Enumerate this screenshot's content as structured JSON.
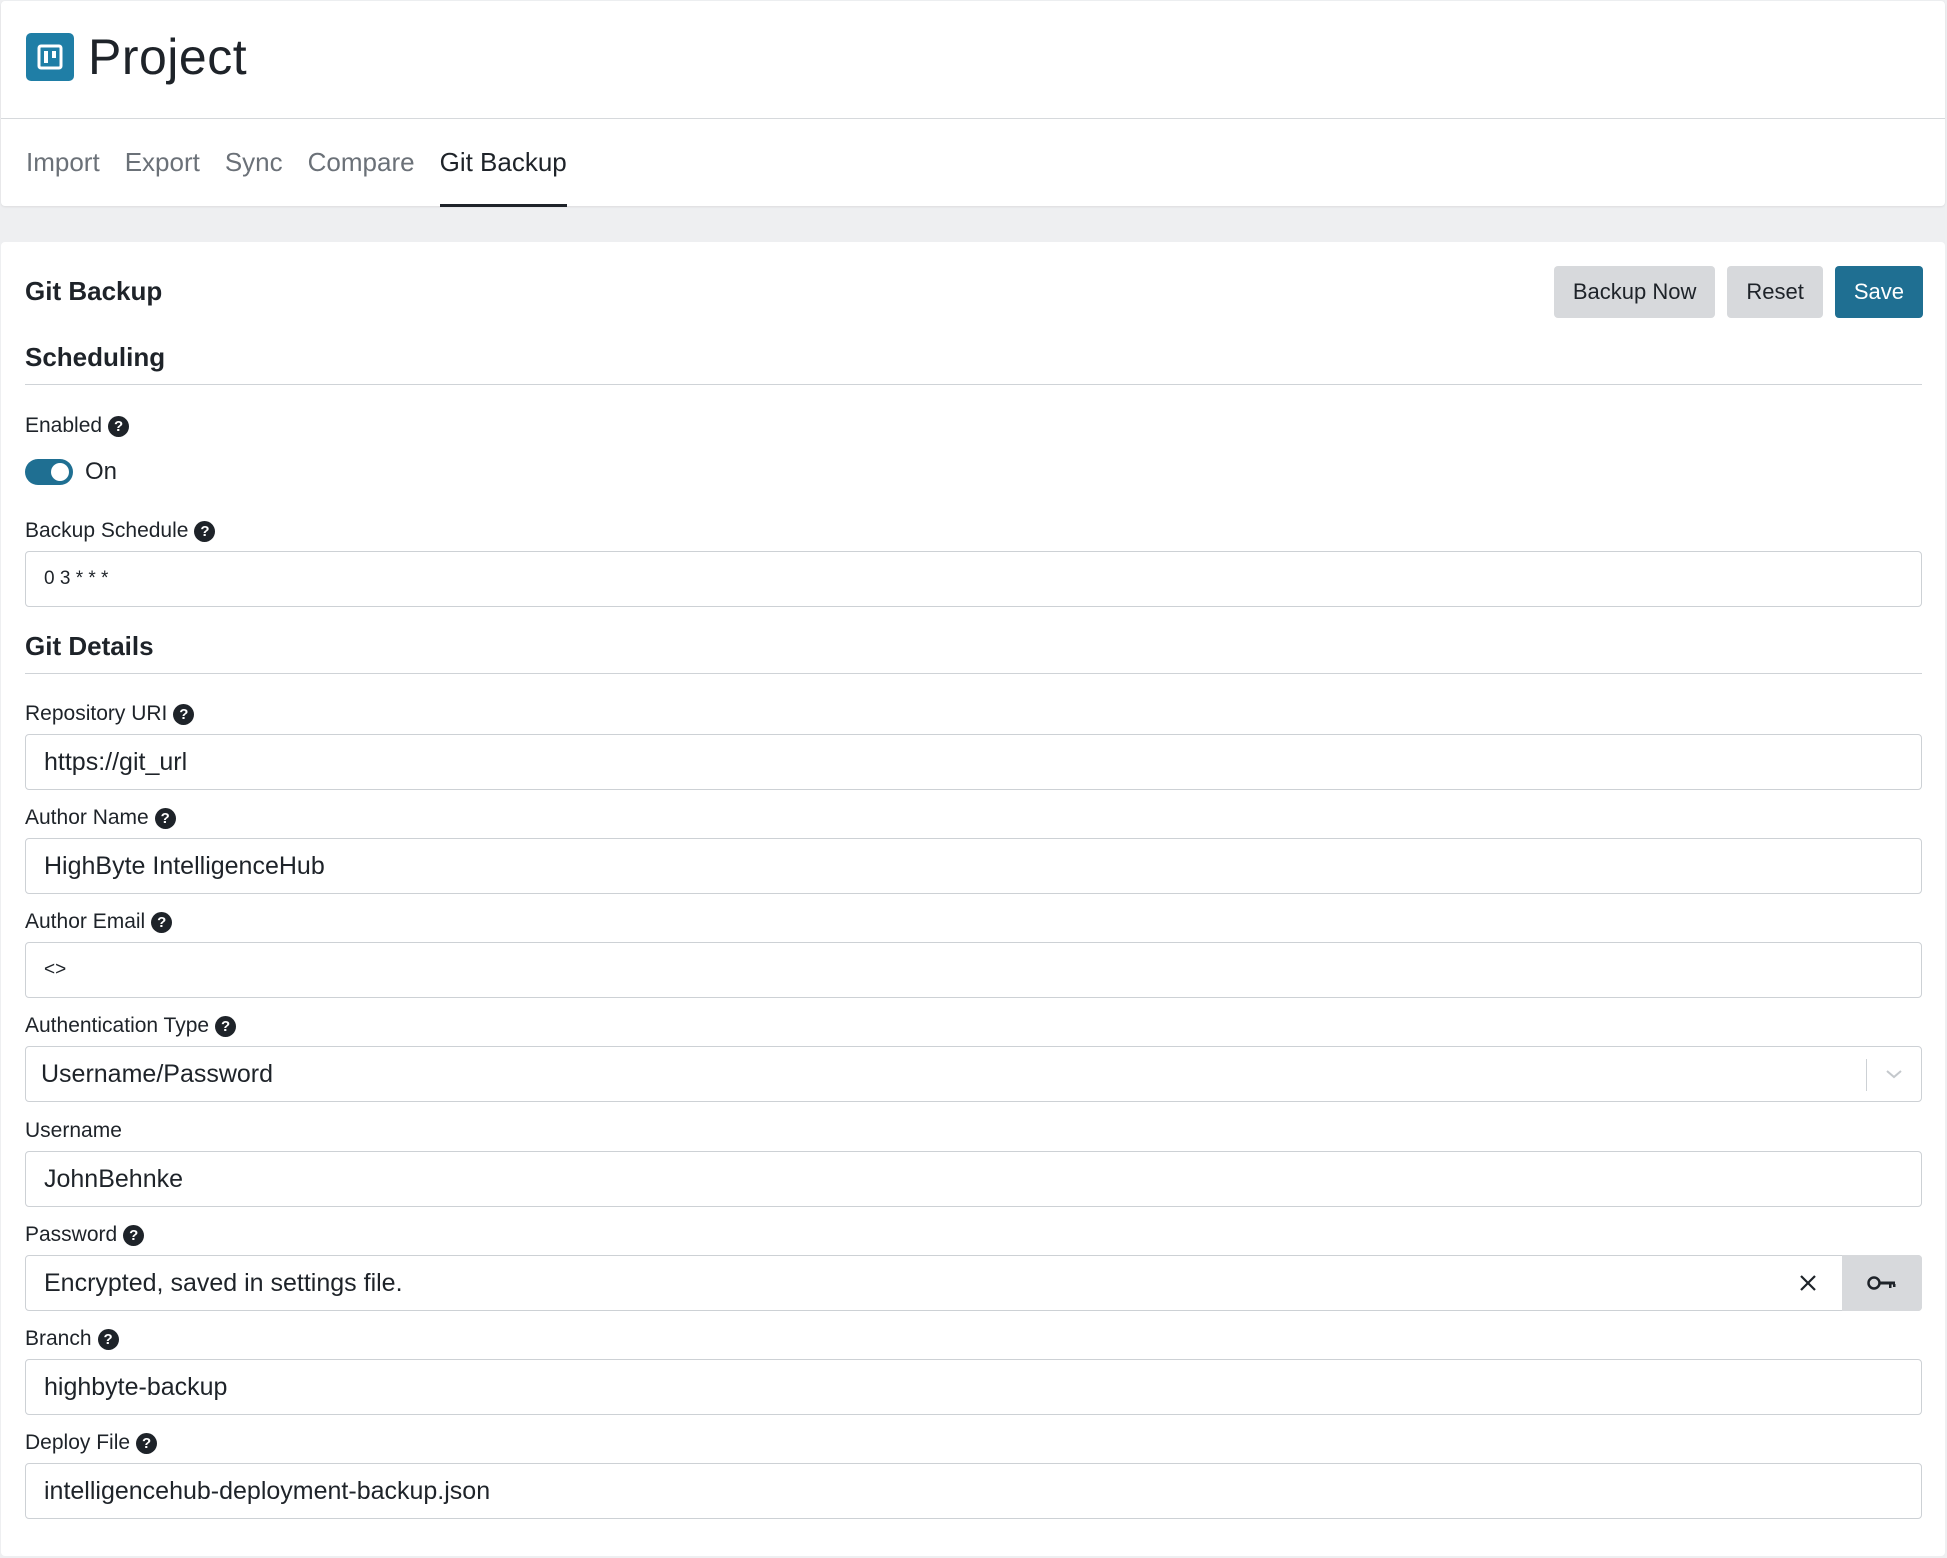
{
  "header": {
    "title": "Project",
    "icon": "project-board-icon",
    "tabs": [
      {
        "label": "Import",
        "active": false
      },
      {
        "label": "Export",
        "active": false
      },
      {
        "label": "Sync",
        "active": false
      },
      {
        "label": "Compare",
        "active": false
      },
      {
        "label": "Git Backup",
        "active": true
      }
    ]
  },
  "card": {
    "title": "Git Backup",
    "actions": {
      "backup_now": "Backup Now",
      "reset": "Reset",
      "save": "Save"
    }
  },
  "scheduling": {
    "section_title": "Scheduling",
    "enabled_label": "Enabled",
    "enabled_state": "On",
    "enabled": true,
    "schedule_label": "Backup Schedule",
    "schedule_value": "0 3 * * *"
  },
  "git_details": {
    "section_title": "Git Details",
    "repo_label": "Repository URI",
    "repo_value": "https://git_url",
    "author_name_label": "Author Name",
    "author_name_value": "HighByte IntelligenceHub",
    "author_email_label": "Author Email",
    "author_email_value": "<>",
    "auth_type_label": "Authentication Type",
    "auth_type_value": "Username/Password",
    "username_label": "Username",
    "username_value": "JohnBehnke",
    "password_label": "Password",
    "password_value": "Encrypted, saved in settings file.",
    "branch_label": "Branch",
    "branch_value": "highbyte-backup",
    "deploy_file_label": "Deploy File",
    "deploy_file_value": "intelligencehub-deployment-backup.json"
  },
  "colors": {
    "accent": "#1f6f92",
    "icon_bg": "#1f7ea6",
    "secondary_button": "#d7d9dc",
    "page_bg": "#eeeff1"
  }
}
